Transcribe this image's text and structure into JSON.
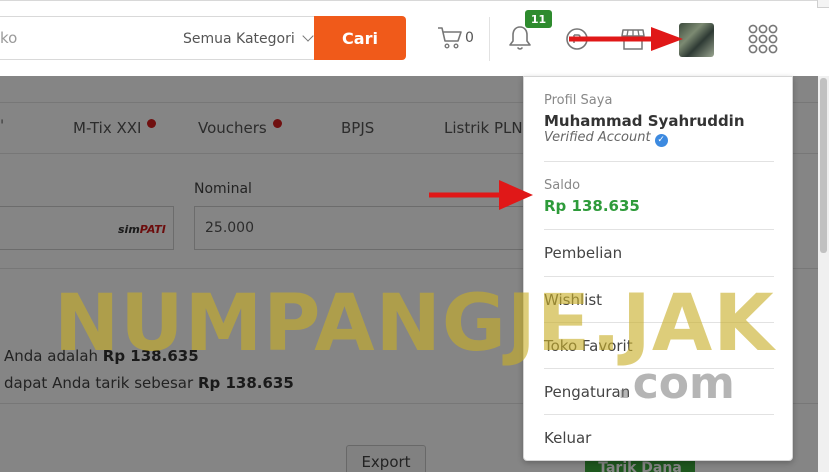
{
  "header": {
    "search_value": "ko",
    "category": "Semua Kategori",
    "search_button": "Cari",
    "cart_count": "0",
    "notification_count": "11"
  },
  "page": {
    "tabs": [
      "M-Tix XXI",
      "Vouchers",
      "BPJS",
      "Listrik PLN"
    ],
    "tab_partial": "",
    "provider_logo": [
      "sim",
      "PATI"
    ],
    "nominal_label": "Nominal",
    "nominal_value": "25.000",
    "info1_text": "Anda adalah ",
    "info1_amount": "Rp 138.635",
    "info2_text": "dapat Anda tarik sebesar ",
    "info2_amount": "Rp 138.635",
    "export_button": "Export",
    "withdraw_button": "Tarik Dana"
  },
  "dropdown": {
    "profile_label": "Profil Saya",
    "user_name": "Muhammad Syahruddin",
    "verified_text": "Verified Account",
    "saldo_label": "Saldo",
    "saldo_value": "Rp 138.635",
    "menu_items": [
      "Pembelian",
      "Wishlist",
      "Toko Favorit",
      "Pengaturan",
      "Keluar"
    ]
  },
  "watermark": {
    "line1": "NUMPANGJE.JAK",
    "line2": ".com"
  },
  "colors": {
    "accent_orange": "#f05a1a",
    "saldo_green": "#2e9b3a",
    "badge_green": "#2e8b2e",
    "arrow_red": "#e01818"
  }
}
